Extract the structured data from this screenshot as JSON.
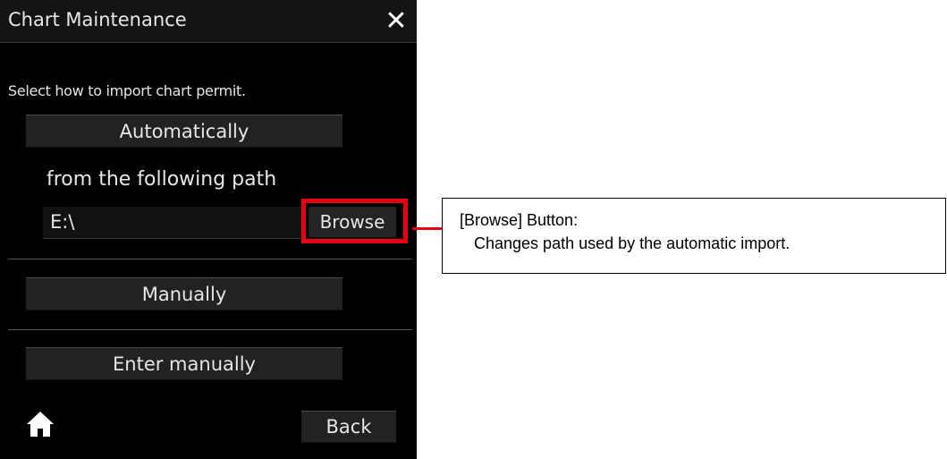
{
  "dialog": {
    "title": "Chart Maintenance",
    "close_icon": "close-icon",
    "instruction": "Select how to import chart permit.",
    "automatic_button": "Automatically",
    "path_label": "from the following path",
    "path_value": "E:\\",
    "browse_button": "Browse",
    "manual_button": "Manually",
    "enter_manual_button": "Enter manually",
    "home_icon": "home-icon",
    "back_button": "Back"
  },
  "callout": {
    "title": "[Browse] Button:",
    "description": "Changes path used by the automatic import.",
    "highlight_color": "#e60012"
  }
}
